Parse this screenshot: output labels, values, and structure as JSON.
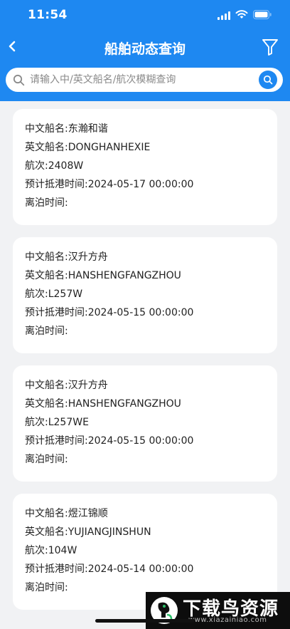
{
  "status_bar": {
    "time": "11:54"
  },
  "header": {
    "title": "船舶动态查询"
  },
  "search": {
    "placeholder": "请输入中/英文船名/航次模糊查询",
    "value": ""
  },
  "ships": [
    {
      "cn_name": "中文船名:东瀚和谐",
      "en_name": "英文船名:DONGHANHEXIE",
      "voyage": "航次:2408W",
      "eta": "预计抵港时间:2024-05-17 00:00:00",
      "departure": "离泊时间:"
    },
    {
      "cn_name": "中文船名:汉升方舟",
      "en_name": "英文船名:HANSHENGFANGZHOU",
      "voyage": "航次:L257W",
      "eta": "预计抵港时间:2024-05-15 00:00:00",
      "departure": "离泊时间:"
    },
    {
      "cn_name": "中文船名:汉升方舟",
      "en_name": "英文船名:HANSHENGFANGZHOU",
      "voyage": "航次:L257WE",
      "eta": "预计抵港时间:2024-05-15 00:00:00",
      "departure": "离泊时间:"
    },
    {
      "cn_name": "中文船名:煜江锦顺",
      "en_name": "英文船名:YUJIANGJINSHUN",
      "voyage": "航次:104W",
      "eta": "预计抵港时间:2024-05-14 00:00:00",
      "departure": "离泊时间:"
    }
  ],
  "watermark": {
    "text": "下载鸟资源",
    "url": "www.xiazainiao.com"
  },
  "icons": {
    "back": "chevron-left-icon",
    "filter": "filter-icon",
    "search": "search-icon"
  },
  "colors": {
    "primary": "#1e88f1",
    "background": "#f1f2f4",
    "card": "#ffffff"
  }
}
